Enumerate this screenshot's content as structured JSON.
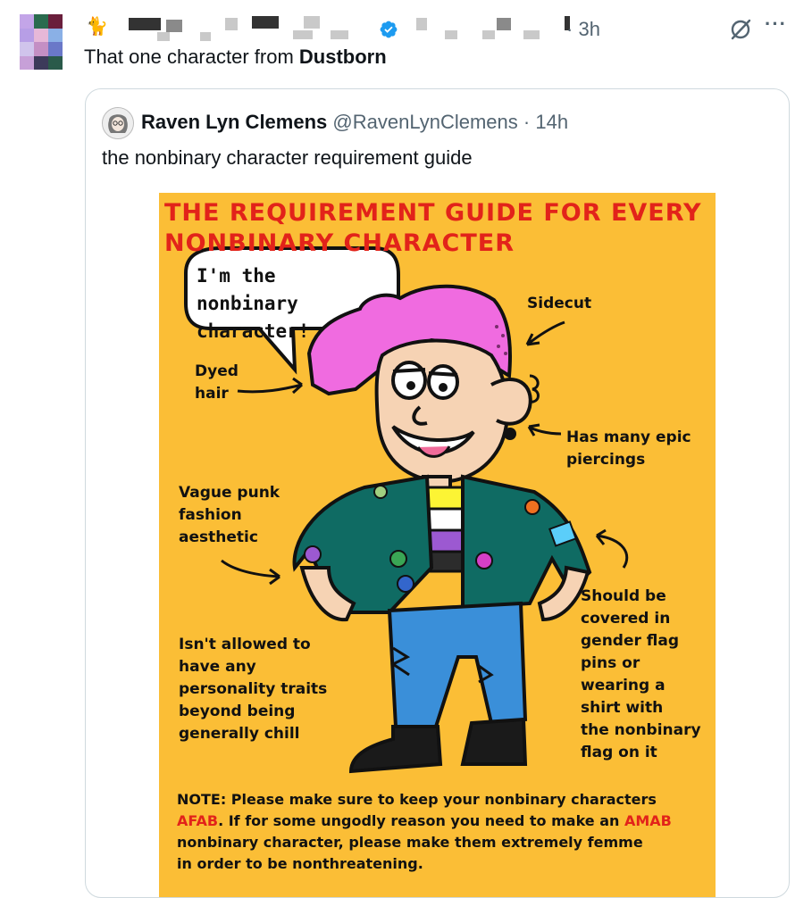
{
  "post": {
    "time": "3h",
    "text_prefix": "That one character from ",
    "text_bold": "Dustborn",
    "icons": {
      "cat": "cat-emoji",
      "verified": "verified-badge-icon",
      "grok": "grok-icon",
      "more": "more-options-icon"
    },
    "more_glyph": "···",
    "cat_glyph": "🐈"
  },
  "quote": {
    "name": "Raven Lyn Clemens",
    "handle": "@RavenLynClemens",
    "time": "14h",
    "text": "the nonbinary character requirement guide"
  },
  "comic": {
    "title_line1": "THE REQUIREMENT GUIDE FOR EVERY",
    "title_line2": "NONBINARY CHARACTER",
    "bubble_line1": "I'm the nonbinary",
    "bubble_line2": "character!",
    "label_sidecut": "Sidecut",
    "label_dyed_hair_1": "Dyed",
    "label_dyed_hair_2": "hair",
    "label_piercings_1": "Has many epic",
    "label_piercings_2": "piercings",
    "label_punk_1": "Vague punk",
    "label_punk_2": "fashion",
    "label_punk_3": "aesthetic",
    "label_traits_1": "Isn't allowed to",
    "label_traits_2": "have any",
    "label_traits_3": "personality traits",
    "label_traits_4": "beyond being",
    "label_traits_5": "generally chill",
    "label_pins_1": "Should be",
    "label_pins_2": "covered in",
    "label_pins_3": "gender flag",
    "label_pins_4": "pins or",
    "label_pins_5": "wearing a",
    "label_pins_6": "shirt with",
    "label_pins_7": "the nonbinary",
    "label_pins_8": "flag on it",
    "note_1a": "NOTE: Please make sure to keep your nonbinary characters",
    "note_2a": "AFAB",
    "note_2b": ". If for some ungodly reason you need to make an ",
    "note_2c": "AMAB",
    "note_3": "nonbinary character, please make them extremely femme",
    "note_4": "in order to be nonthreatening."
  },
  "colors": {
    "text": "#0f1419",
    "secondary": "#536471",
    "verified": "#1d9bf0",
    "comic_bg": "#fbbe36",
    "comic_red": "#e2231a",
    "hair": "#f06be0",
    "jacket": "#0f6b63",
    "jeans": "#3a8fd9"
  }
}
